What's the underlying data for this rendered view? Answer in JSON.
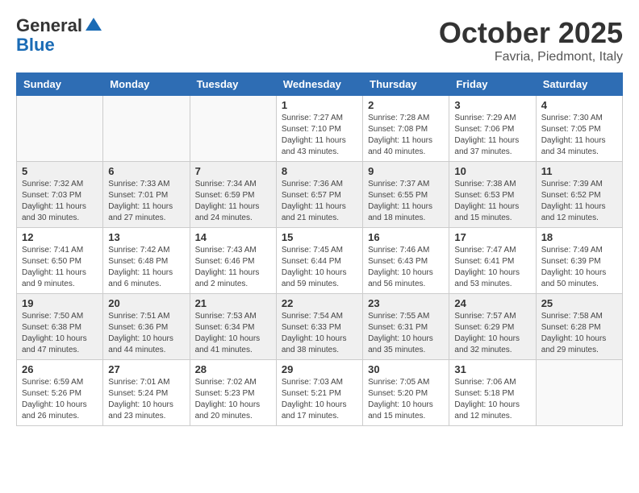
{
  "header": {
    "logo_line1": "General",
    "logo_line2": "Blue",
    "month": "October 2025",
    "location": "Favria, Piedmont, Italy"
  },
  "weekdays": [
    "Sunday",
    "Monday",
    "Tuesday",
    "Wednesday",
    "Thursday",
    "Friday",
    "Saturday"
  ],
  "weeks": [
    [
      {
        "day": "",
        "sunrise": "",
        "sunset": "",
        "daylight": ""
      },
      {
        "day": "",
        "sunrise": "",
        "sunset": "",
        "daylight": ""
      },
      {
        "day": "",
        "sunrise": "",
        "sunset": "",
        "daylight": ""
      },
      {
        "day": "1",
        "sunrise": "Sunrise: 7:27 AM",
        "sunset": "Sunset: 7:10 PM",
        "daylight": "Daylight: 11 hours and 43 minutes."
      },
      {
        "day": "2",
        "sunrise": "Sunrise: 7:28 AM",
        "sunset": "Sunset: 7:08 PM",
        "daylight": "Daylight: 11 hours and 40 minutes."
      },
      {
        "day": "3",
        "sunrise": "Sunrise: 7:29 AM",
        "sunset": "Sunset: 7:06 PM",
        "daylight": "Daylight: 11 hours and 37 minutes."
      },
      {
        "day": "4",
        "sunrise": "Sunrise: 7:30 AM",
        "sunset": "Sunset: 7:05 PM",
        "daylight": "Daylight: 11 hours and 34 minutes."
      }
    ],
    [
      {
        "day": "5",
        "sunrise": "Sunrise: 7:32 AM",
        "sunset": "Sunset: 7:03 PM",
        "daylight": "Daylight: 11 hours and 30 minutes."
      },
      {
        "day": "6",
        "sunrise": "Sunrise: 7:33 AM",
        "sunset": "Sunset: 7:01 PM",
        "daylight": "Daylight: 11 hours and 27 minutes."
      },
      {
        "day": "7",
        "sunrise": "Sunrise: 7:34 AM",
        "sunset": "Sunset: 6:59 PM",
        "daylight": "Daylight: 11 hours and 24 minutes."
      },
      {
        "day": "8",
        "sunrise": "Sunrise: 7:36 AM",
        "sunset": "Sunset: 6:57 PM",
        "daylight": "Daylight: 11 hours and 21 minutes."
      },
      {
        "day": "9",
        "sunrise": "Sunrise: 7:37 AM",
        "sunset": "Sunset: 6:55 PM",
        "daylight": "Daylight: 11 hours and 18 minutes."
      },
      {
        "day": "10",
        "sunrise": "Sunrise: 7:38 AM",
        "sunset": "Sunset: 6:53 PM",
        "daylight": "Daylight: 11 hours and 15 minutes."
      },
      {
        "day": "11",
        "sunrise": "Sunrise: 7:39 AM",
        "sunset": "Sunset: 6:52 PM",
        "daylight": "Daylight: 11 hours and 12 minutes."
      }
    ],
    [
      {
        "day": "12",
        "sunrise": "Sunrise: 7:41 AM",
        "sunset": "Sunset: 6:50 PM",
        "daylight": "Daylight: 11 hours and 9 minutes."
      },
      {
        "day": "13",
        "sunrise": "Sunrise: 7:42 AM",
        "sunset": "Sunset: 6:48 PM",
        "daylight": "Daylight: 11 hours and 6 minutes."
      },
      {
        "day": "14",
        "sunrise": "Sunrise: 7:43 AM",
        "sunset": "Sunset: 6:46 PM",
        "daylight": "Daylight: 11 hours and 2 minutes."
      },
      {
        "day": "15",
        "sunrise": "Sunrise: 7:45 AM",
        "sunset": "Sunset: 6:44 PM",
        "daylight": "Daylight: 10 hours and 59 minutes."
      },
      {
        "day": "16",
        "sunrise": "Sunrise: 7:46 AM",
        "sunset": "Sunset: 6:43 PM",
        "daylight": "Daylight: 10 hours and 56 minutes."
      },
      {
        "day": "17",
        "sunrise": "Sunrise: 7:47 AM",
        "sunset": "Sunset: 6:41 PM",
        "daylight": "Daylight: 10 hours and 53 minutes."
      },
      {
        "day": "18",
        "sunrise": "Sunrise: 7:49 AM",
        "sunset": "Sunset: 6:39 PM",
        "daylight": "Daylight: 10 hours and 50 minutes."
      }
    ],
    [
      {
        "day": "19",
        "sunrise": "Sunrise: 7:50 AM",
        "sunset": "Sunset: 6:38 PM",
        "daylight": "Daylight: 10 hours and 47 minutes."
      },
      {
        "day": "20",
        "sunrise": "Sunrise: 7:51 AM",
        "sunset": "Sunset: 6:36 PM",
        "daylight": "Daylight: 10 hours and 44 minutes."
      },
      {
        "day": "21",
        "sunrise": "Sunrise: 7:53 AM",
        "sunset": "Sunset: 6:34 PM",
        "daylight": "Daylight: 10 hours and 41 minutes."
      },
      {
        "day": "22",
        "sunrise": "Sunrise: 7:54 AM",
        "sunset": "Sunset: 6:33 PM",
        "daylight": "Daylight: 10 hours and 38 minutes."
      },
      {
        "day": "23",
        "sunrise": "Sunrise: 7:55 AM",
        "sunset": "Sunset: 6:31 PM",
        "daylight": "Daylight: 10 hours and 35 minutes."
      },
      {
        "day": "24",
        "sunrise": "Sunrise: 7:57 AM",
        "sunset": "Sunset: 6:29 PM",
        "daylight": "Daylight: 10 hours and 32 minutes."
      },
      {
        "day": "25",
        "sunrise": "Sunrise: 7:58 AM",
        "sunset": "Sunset: 6:28 PM",
        "daylight": "Daylight: 10 hours and 29 minutes."
      }
    ],
    [
      {
        "day": "26",
        "sunrise": "Sunrise: 6:59 AM",
        "sunset": "Sunset: 5:26 PM",
        "daylight": "Daylight: 10 hours and 26 minutes."
      },
      {
        "day": "27",
        "sunrise": "Sunrise: 7:01 AM",
        "sunset": "Sunset: 5:24 PM",
        "daylight": "Daylight: 10 hours and 23 minutes."
      },
      {
        "day": "28",
        "sunrise": "Sunrise: 7:02 AM",
        "sunset": "Sunset: 5:23 PM",
        "daylight": "Daylight: 10 hours and 20 minutes."
      },
      {
        "day": "29",
        "sunrise": "Sunrise: 7:03 AM",
        "sunset": "Sunset: 5:21 PM",
        "daylight": "Daylight: 10 hours and 17 minutes."
      },
      {
        "day": "30",
        "sunrise": "Sunrise: 7:05 AM",
        "sunset": "Sunset: 5:20 PM",
        "daylight": "Daylight: 10 hours and 15 minutes."
      },
      {
        "day": "31",
        "sunrise": "Sunrise: 7:06 AM",
        "sunset": "Sunset: 5:18 PM",
        "daylight": "Daylight: 10 hours and 12 minutes."
      },
      {
        "day": "",
        "sunrise": "",
        "sunset": "",
        "daylight": ""
      }
    ]
  ],
  "row_shading": [
    false,
    true,
    false,
    true,
    false
  ]
}
